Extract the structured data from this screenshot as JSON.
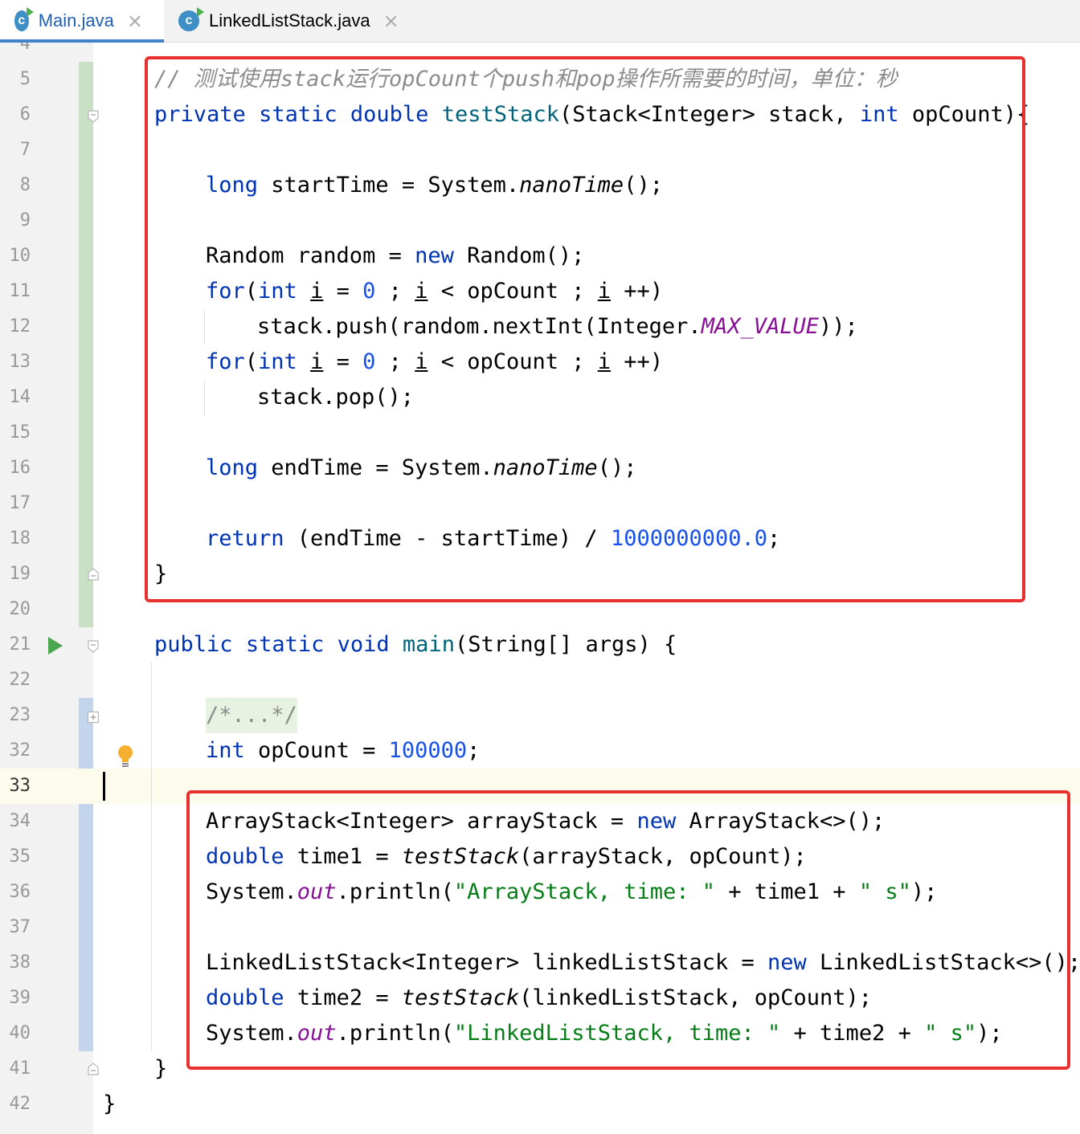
{
  "tabs": [
    {
      "label": "Main.java",
      "active": true,
      "icon": "java-class-icon"
    },
    {
      "label": "LinkedListStack.java",
      "active": false,
      "icon": "java-class-icon"
    }
  ],
  "lines": [
    {
      "n": "4"
    },
    {
      "n": "5"
    },
    {
      "n": "6"
    },
    {
      "n": "7"
    },
    {
      "n": "8"
    },
    {
      "n": "9"
    },
    {
      "n": "10"
    },
    {
      "n": "11"
    },
    {
      "n": "12"
    },
    {
      "n": "13"
    },
    {
      "n": "14"
    },
    {
      "n": "15"
    },
    {
      "n": "16"
    },
    {
      "n": "17"
    },
    {
      "n": "18"
    },
    {
      "n": "19"
    },
    {
      "n": "20"
    },
    {
      "n": "21"
    },
    {
      "n": "22"
    },
    {
      "n": "23"
    },
    {
      "n": "32"
    },
    {
      "n": "33"
    },
    {
      "n": "34"
    },
    {
      "n": "35"
    },
    {
      "n": "36"
    },
    {
      "n": "37"
    },
    {
      "n": "38"
    },
    {
      "n": "39"
    },
    {
      "n": "40"
    },
    {
      "n": "41"
    },
    {
      "n": "42"
    }
  ],
  "code": {
    "l5": "// 测试使用stack运行opCount个push和pop操作所需要的时间，单位：秒",
    "l6": [
      "private",
      "static",
      "double",
      "testStack",
      "(Stack<Integer> stack, ",
      "int",
      " opCount){"
    ],
    "l8": [
      "long",
      " startTime = System.",
      "nanoTime",
      "();"
    ],
    "l10": [
      "Random random = ",
      "new",
      " Random();"
    ],
    "l11": [
      "for",
      "(",
      "int",
      " ",
      "i",
      " = ",
      "0",
      " ; ",
      "i",
      " < opCount ; ",
      "i",
      " ++)"
    ],
    "l12": [
      "stack.push(random.nextInt(Integer.",
      "MAX_VALUE",
      "));"
    ],
    "l13": [
      "for",
      "(",
      "int",
      " ",
      "i",
      " = ",
      "0",
      " ; ",
      "i",
      " < opCount ; ",
      "i",
      " ++)"
    ],
    "l14": "stack.pop();",
    "l16": [
      "long",
      " endTime = System.",
      "nanoTime",
      "();"
    ],
    "l18": [
      "return",
      " (endTime - startTime) / ",
      "1000000000.0",
      ";"
    ],
    "l19": "}",
    "l21": [
      "public",
      "static",
      "void",
      "main",
      "(String[] args) {"
    ],
    "l23": "/*...*/",
    "l32": [
      "int",
      " opCount = ",
      "100000",
      ";"
    ],
    "l34": [
      "ArrayStack<Integer> arrayStack = ",
      "new",
      " ArrayStack<>();"
    ],
    "l35": [
      "double",
      " time1 = ",
      "testStack",
      "(arrayStack, opCount);"
    ],
    "l36": [
      "System.",
      "out",
      ".println(",
      "\"ArrayStack, time: \"",
      " + time1 + ",
      "\" s\"",
      ");"
    ],
    "l38": [
      "LinkedListStack<Integer> linkedListStack = ",
      "new",
      " LinkedListStack<>();"
    ],
    "l39": [
      "double",
      " time2 = ",
      "testStack",
      "(linkedListStack, opCount);"
    ],
    "l40": [
      "System.",
      "out",
      ".println(",
      "\"LinkedListStack, time: \"",
      " + time2 + ",
      "\" s\"",
      ");"
    ],
    "l41": "}",
    "l42": "}"
  },
  "colors": {
    "keyword": "#0033b3",
    "method": "#00627a",
    "number": "#1750eb",
    "string": "#067d17",
    "comment": "#8c8c8c",
    "static_field": "#871094",
    "highlight_box": "#e8302e",
    "vcs_added": "#c9e0c4",
    "vcs_modified": "#c3d5ea"
  }
}
